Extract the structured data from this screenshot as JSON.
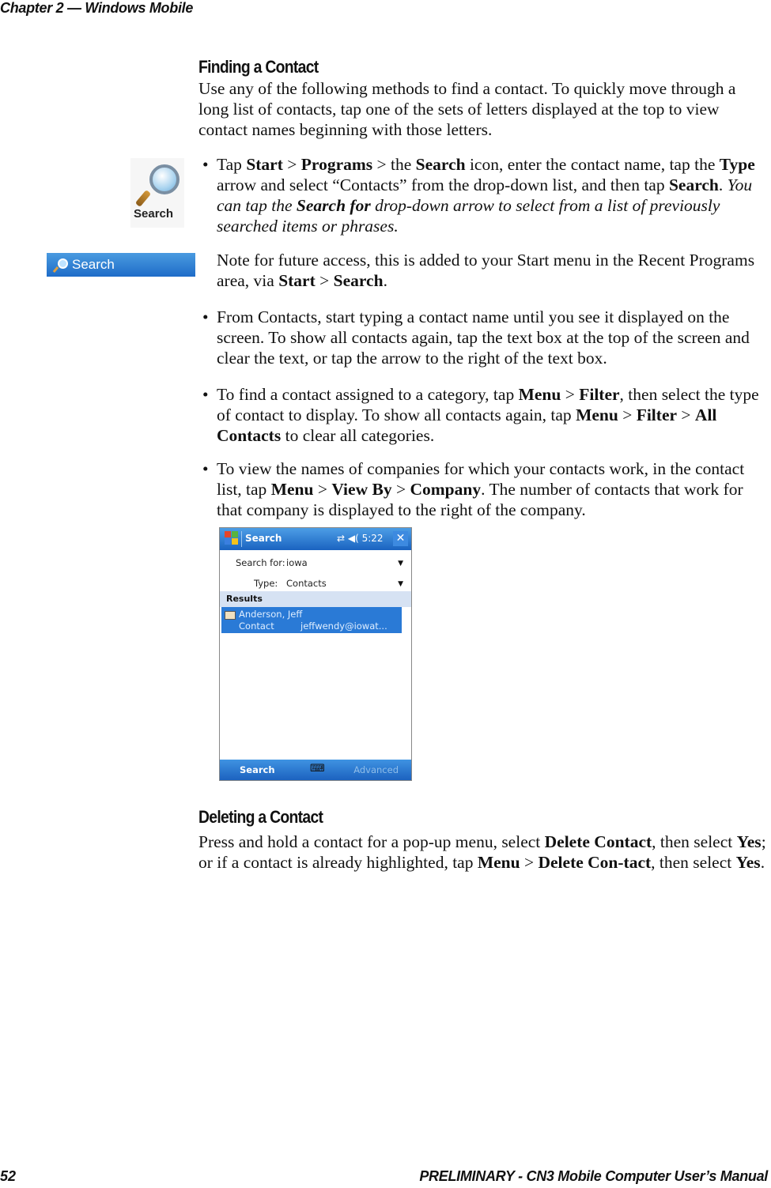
{
  "page_header": "Chapter 2 — Windows Mobile",
  "footer": {
    "page_number": "52",
    "manual_title": "PRELIMINARY - CN3 Mobile Computer User’s Manual"
  },
  "finding": {
    "heading": "Finding a Contact",
    "intro": "Use any of the following methods to find a contact. To quickly move through a long list of contacts, tap one of the sets of letters displayed at the top to view contact names beginning with those letters.",
    "bullet1": {
      "p1": "Tap ",
      "start": "Start",
      "gt1": " > ",
      "programs": "Programs",
      "p2": " > the ",
      "search": "Search",
      "p3": " icon, enter the contact name, tap the ",
      "type": "Type",
      "p4": " arrow and select “Contacts” from the drop-down list, and then tap ",
      "search2": "Search",
      "p5": ". ",
      "i1": "You can tap the ",
      "searchfor": "Search for",
      "i2": " drop-down arrow to select from a list of previously searched items or phrases."
    },
    "note": {
      "p1": "Note for future access, this is added to your Start menu in the Recent Programs area, via ",
      "start": "Start",
      "gt": " > ",
      "search": "Search",
      "p2": "."
    },
    "bullet2": "From Contacts, start typing a contact name until you see it displayed on the screen. To show all contacts again, tap the text box at the top of the screen and clear the text, or tap the arrow to the right of the text box.",
    "bullet3": {
      "p1": "To find a contact assigned to a category, tap ",
      "menu": "Menu",
      "gt": " > ",
      "filter": "Filter",
      "p2": ", then select the type of contact to display. To show all contacts again, tap ",
      "menu2": "Menu",
      "gt2": " > ",
      "filter2": "Filter",
      "gt3": " > ",
      "all": "All Contacts",
      "p3": " to clear all categories."
    },
    "bullet4": {
      "p1": "To view the names of companies for which your contacts work, in the contact list, tap ",
      "menu": "Menu",
      "gt": " > ",
      "viewby": "View By",
      "gt2": " > ",
      "company": "Company",
      "p2": ". The number of contacts that work for that company is displayed to the right of the company."
    }
  },
  "icons": {
    "search_icon_label": "Search",
    "search_bar_label": "Search"
  },
  "phone": {
    "title": "Search",
    "status": "⇄ ◀( 5:22",
    "close": "✕",
    "search_for_label": "Search for:",
    "search_for_value": "iowa",
    "type_label": "Type:",
    "type_value": "Contacts",
    "results_header": "Results",
    "result": {
      "name": "Anderson, Jeff",
      "kind": "Contact",
      "email": "jeffwendy@iowat..."
    },
    "softkey_left": "Search",
    "softkey_right": "Advanced",
    "keyboard_icon": "⌨"
  },
  "deleting": {
    "heading": "Deleting a Contact",
    "p1": "Press and hold a contact for a pop-up menu, select ",
    "delete": "Delete Contact",
    "p2": ", then select ",
    "yes": "Yes",
    "p3": "; or if a contact is already highlighted, tap ",
    "menu": "Menu",
    "gt": " > ",
    "delete2": "Delete Con-tact",
    "p4": ", then select ",
    "yes2": "Yes",
    "p5": "."
  }
}
